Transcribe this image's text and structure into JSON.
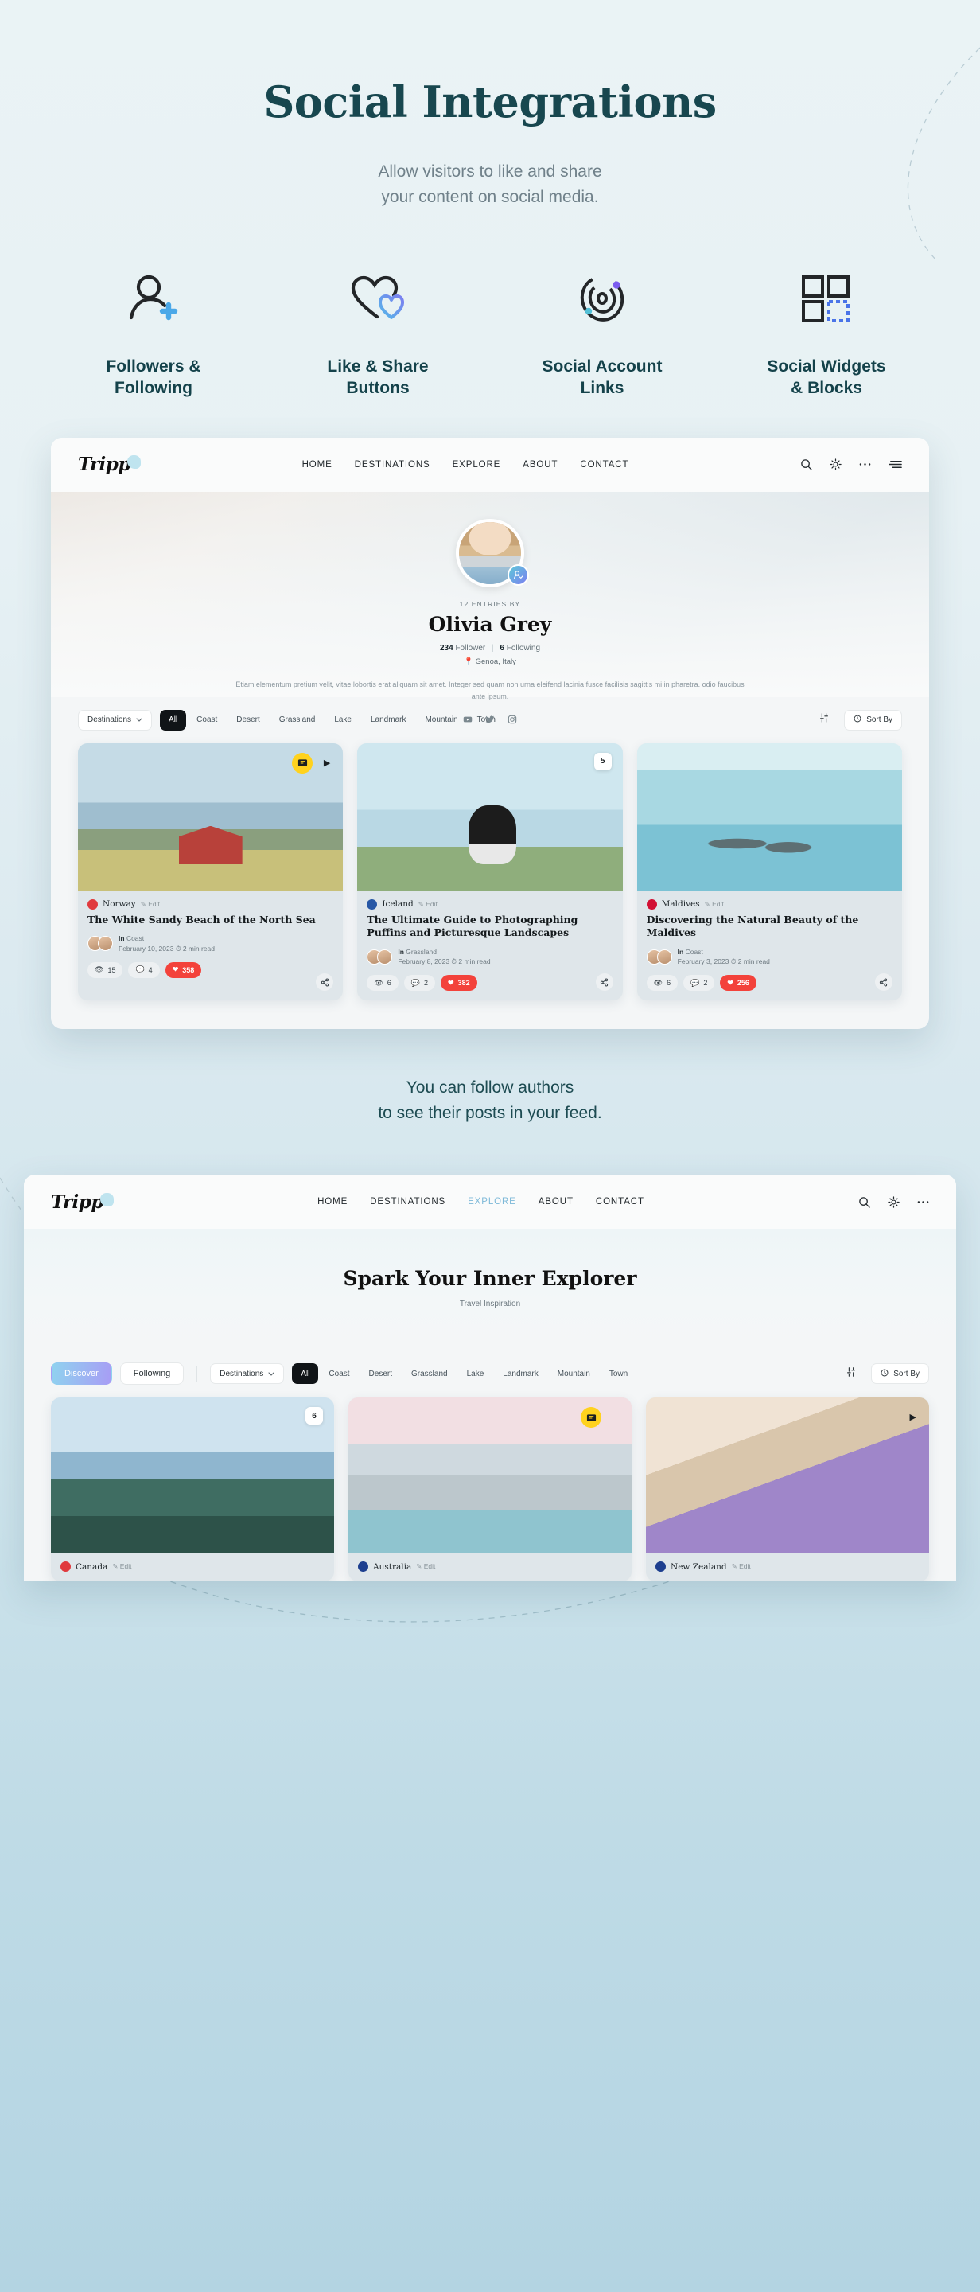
{
  "header": {
    "title": "Social Integrations",
    "subtitle_line1": "Allow visitors to like and share",
    "subtitle_line2": "your content on social media."
  },
  "features": [
    {
      "icon": "user-plus-icon",
      "label_line1": "Followers &",
      "label_line2": "Following"
    },
    {
      "icon": "heart-share-icon",
      "label_line1": "Like & Share",
      "label_line2": "Buttons"
    },
    {
      "icon": "orbit-account-icon",
      "label_line1": "Social Account",
      "label_line2": "Links"
    },
    {
      "icon": "widget-blocks-icon",
      "label_line1": "Social Widgets",
      "label_line2": "& Blocks"
    }
  ],
  "colors": {
    "accent_teal": "#18474f",
    "accent_blue": "#4f93e8",
    "accent_purple": "#7b7ff0",
    "like_red": "#f3423b",
    "badge_yellow": "#ffd21e"
  },
  "mock1": {
    "logo": "Tripp",
    "nav": [
      {
        "label": "HOME",
        "active": false
      },
      {
        "label": "DESTINATIONS",
        "active": false
      },
      {
        "label": "EXPLORE",
        "active": false
      },
      {
        "label": "ABOUT",
        "active": false
      },
      {
        "label": "CONTACT",
        "active": false
      }
    ],
    "nav_icons": [
      "search-icon",
      "theme-sun-icon",
      "more-dots-icon",
      "menu-icon"
    ],
    "profile": {
      "entries": "12 ENTRIES BY",
      "name": "Olivia Grey",
      "followers": "234",
      "followers_label": "Follower",
      "following": "6",
      "following_label": "Following",
      "location": "Genoa, Italy",
      "bio": "Etiam elementum pretium velit, vitae lobortis erat aliquam sit amet. Integer sed quam non urna eleifend lacinia fusce facilisis sagittis mi in pharetra. odio faucibus ante ipsum.",
      "socials": [
        "youtube-icon",
        "twitter-icon",
        "instagram-icon"
      ]
    },
    "filters": {
      "dropdown": "Destinations",
      "chips": [
        "All",
        "Coast",
        "Desert",
        "Grassland",
        "Lake",
        "Landmark",
        "Mountain",
        "Town"
      ],
      "active_chip": "All",
      "sort_label": "Sort By"
    },
    "cards": [
      {
        "country": "Norway",
        "flag": "#e03a3e",
        "edit": "Edit",
        "title": "The White Sandy Beach of the North Sea",
        "category_prefix": "In",
        "category": "Coast",
        "date": "February 10, 2023",
        "read": "2 min read",
        "views": "15",
        "comments": "4",
        "likes": "358",
        "badge": "ticket-yellow",
        "play": true
      },
      {
        "country": "Iceland",
        "flag": "#2757a5",
        "edit": "Edit",
        "title": "The Ultimate Guide to Photographing Puffins and Picturesque Landscapes",
        "category_prefix": "In",
        "category": "Grassland",
        "date": "February 8, 2023",
        "read": "2 min read",
        "views": "6",
        "comments": "2",
        "likes": "382",
        "badge_count": "5"
      },
      {
        "country": "Maldives",
        "flag": "#d21034",
        "edit": "Edit",
        "title": "Discovering the Natural Beauty of the Maldives",
        "category_prefix": "In",
        "category": "Coast",
        "date": "February 3, 2023",
        "read": "2 min read",
        "views": "6",
        "comments": "2",
        "likes": "256"
      }
    ]
  },
  "caption": {
    "line1": "You can follow authors",
    "line2": "to see their posts in your feed."
  },
  "mock2": {
    "logo": "Tripp",
    "nav": [
      {
        "label": "HOME",
        "active": false
      },
      {
        "label": "DESTINATIONS",
        "active": false
      },
      {
        "label": "EXPLORE",
        "active": true
      },
      {
        "label": "ABOUT",
        "active": false
      },
      {
        "label": "CONTACT",
        "active": false
      }
    ],
    "hero_title": "Spark Your Inner Explorer",
    "hero_subtitle": "Travel Inspiration",
    "tabs": [
      {
        "label": "Discover",
        "active": true
      },
      {
        "label": "Following",
        "active": false
      }
    ],
    "filters": {
      "dropdown": "Destinations",
      "chips": [
        "All",
        "Coast",
        "Desert",
        "Grassland",
        "Lake",
        "Landmark",
        "Mountain",
        "Town"
      ],
      "active_chip": "All",
      "sort_label": "Sort By"
    },
    "cards": [
      {
        "country": "Canada",
        "flag": "#e03a3e",
        "edit": "Edit",
        "badge_count": "6"
      },
      {
        "country": "Australia",
        "flag": "#1d3f8f",
        "edit": "Edit",
        "badge": "ticket-yellow"
      },
      {
        "country": "New Zealand",
        "flag": "#1d3f8f",
        "edit": "Edit",
        "play": true
      }
    ]
  }
}
